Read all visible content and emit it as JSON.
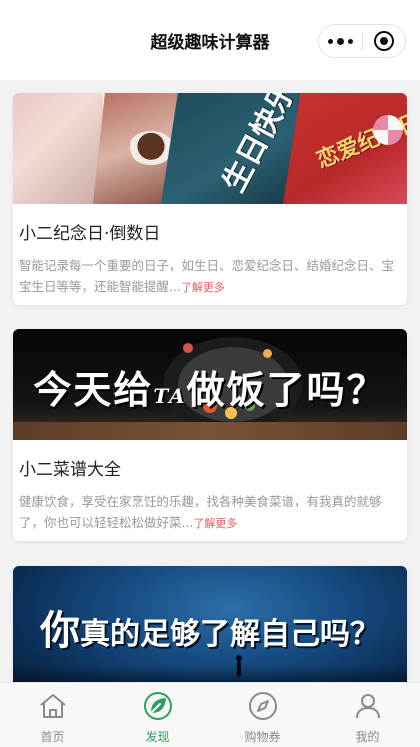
{
  "header": {
    "title": "超级趣味计算器",
    "more_icon": "more-dots-icon",
    "close_icon": "target-circle-icon"
  },
  "cards": [
    {
      "banner_text": "生日快乐",
      "banner_text_2": "恋爱纪念日",
      "title": "小二纪念日·倒数日",
      "desc": "智能记录每一个重要的日子，如生日、恋爱纪念日、结婚纪念日、宝宝生日等等，还能智能提醒...",
      "more": "了解更多"
    },
    {
      "banner_text_a": "今天给",
      "banner_text_ta": "TA",
      "banner_text_b": "做饭了吗？",
      "title": "小二菜谱大全",
      "desc": "健康饮食，享受在家烹饪的乐趣，找各种美食菜谱，有我真的就够了，你也可以轻轻松松做好菜...",
      "more": "了解更多"
    },
    {
      "banner_text_big": "你",
      "banner_text_rest": "真的足够了解自己吗？"
    }
  ],
  "tabbar": {
    "accent_color": "#2f9e5e",
    "items": [
      {
        "label": "首页",
        "icon": "home-icon",
        "active": false
      },
      {
        "label": "发现",
        "icon": "leaf-discover-icon",
        "active": true
      },
      {
        "label": "购物券",
        "icon": "compass-icon",
        "active": false
      },
      {
        "label": "我的",
        "icon": "user-icon",
        "active": false
      }
    ]
  }
}
